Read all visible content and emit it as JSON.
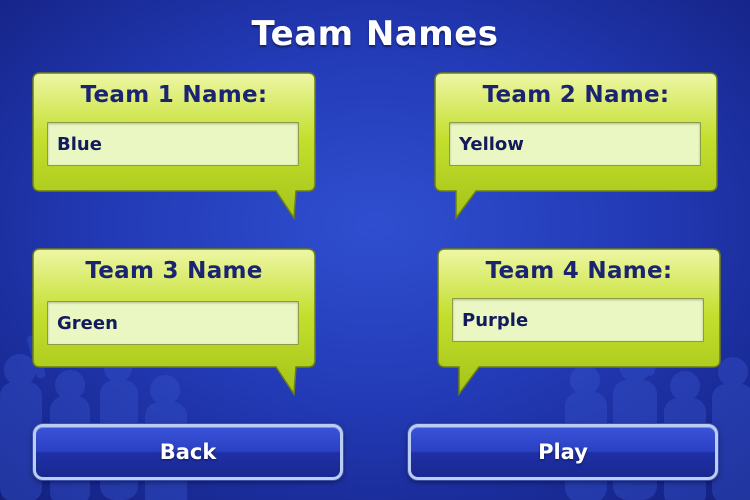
{
  "screen": {
    "title": "Team Names"
  },
  "teams": [
    {
      "label": "Team 1 Name:",
      "value": "Blue"
    },
    {
      "label": "Team 2 Name:",
      "value": "Yellow"
    },
    {
      "label": "Team 3 Name",
      "value": "Green"
    },
    {
      "label": "Team 4 Name:",
      "value": "Purple"
    }
  ],
  "buttons": {
    "back_label": "Back",
    "play_label": "Play"
  },
  "colors": {
    "background": "#2239b4",
    "bubble_green": "#c2e02a",
    "label_navy": "#1b2470",
    "input_fill": "#eaf7c2",
    "button_blue": "#2b41c4",
    "button_border": "#b9cdf5"
  }
}
